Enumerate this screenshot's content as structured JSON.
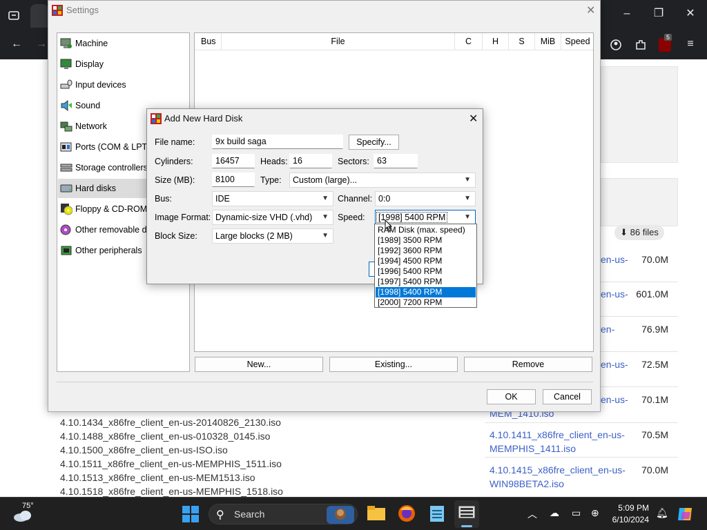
{
  "settings": {
    "title": "Settings",
    "categories": [
      {
        "label": "Machine",
        "icon": "machine-icon"
      },
      {
        "label": "Display",
        "icon": "display-icon"
      },
      {
        "label": "Input devices",
        "icon": "input-devices-icon"
      },
      {
        "label": "Sound",
        "icon": "sound-icon"
      },
      {
        "label": "Network",
        "icon": "network-icon"
      },
      {
        "label": "Ports (COM & LPT)",
        "icon": "ports-icon"
      },
      {
        "label": "Storage controllers",
        "icon": "storage-icon"
      },
      {
        "label": "Hard disks",
        "icon": "hard-disk-icon"
      },
      {
        "label": "Floppy & CD-ROM d",
        "icon": "floppy-icon"
      },
      {
        "label": "Other removable de",
        "icon": "removable-icon"
      },
      {
        "label": "Other peripherals",
        "icon": "peripherals-icon"
      }
    ],
    "selected_category": "Hard disks",
    "table_headers": [
      "Bus",
      "File",
      "C",
      "H",
      "S",
      "MiB",
      "Speed"
    ],
    "buttons": {
      "new": "New...",
      "existing": "Existing...",
      "remove": "Remove"
    },
    "ok": "OK",
    "cancel": "Cancel"
  },
  "dialog": {
    "title": "Add New Hard Disk",
    "file_name_label": "File name:",
    "file_name": "9x build saga",
    "specify_label": "Specify...",
    "cylinders_label": "Cylinders:",
    "cylinders": "16457",
    "heads_label": "Heads:",
    "heads": "16",
    "sectors_label": "Sectors:",
    "sectors": "63",
    "size_label": "Size (MB):",
    "size": "8100",
    "type_label": "Type:",
    "type": "Custom (large)...",
    "bus_label": "Bus:",
    "bus": "IDE",
    "channel_label": "Channel:",
    "channel": "0:0",
    "image_format_label": "Image Format:",
    "image_format": "Dynamic-size VHD (.vhd)",
    "speed_label": "Speed:",
    "speed": "[1998] 5400 RPM",
    "block_size_label": "Block Size:",
    "block_size": "Large blocks (2 MB)",
    "speed_options": [
      "RAM Disk (max. speed)",
      "[1989] 3500 RPM",
      "[1992] 3600 RPM",
      "[1994] 4500 RPM",
      "[1996] 5400 RPM",
      "[1997] 5400 RPM",
      "[1998] 5400 RPM",
      "[2000] 7200 RPM"
    ],
    "speed_selected_index": 6
  },
  "browser": {
    "extension_badge": "5",
    "files_badge": "86 files",
    "left_files": [
      "4.10.1434_x86fre_client_en-us-20140826_2130.iso",
      "4.10.1488_x86fre_client_en-us-010328_0145.iso",
      "4.10.1500_x86fre_client_en-us-ISO.iso",
      "4.10.1511_x86fre_client_en-us-MEMPHIS_1511.iso",
      "4.10.1513_x86fre_client_en-us-MEM1513.iso",
      "4.10.1518_x86fre_client_en-us-MEMPHIS_1518.iso"
    ],
    "right_files": [
      {
        "line1": "en-us-",
        "line2": "",
        "size": "70.0M"
      },
      {
        "line1": "en-us-",
        "line2": "",
        "size": "601.0M"
      },
      {
        "line1": "en-",
        "line2": "",
        "size": "76.9M"
      },
      {
        "line1": "en-us-",
        "line2": "",
        "size": "72.5M"
      },
      {
        "line1": "en-us-",
        "line2": "MEM_1410.iso",
        "size": "70.1M"
      },
      {
        "line1": "4.10.1411_x86fre_client_en-us-",
        "line2": "MEMPHIS_1411.iso",
        "size": "70.5M"
      },
      {
        "line1": "4.10.1415_x86fre_client_en-us-",
        "line2": "WIN98BETA2.iso",
        "size": "70.0M"
      }
    ]
  },
  "taskbar": {
    "weather_temp": "75°",
    "search_label": "Search",
    "time": "5:09 PM",
    "date": "6/10/2024"
  },
  "colors": {
    "accent": "#0078d7",
    "link": "#3b5fc7",
    "window_bg": "#f0f0f0",
    "taskbar_bg": "#202020"
  }
}
